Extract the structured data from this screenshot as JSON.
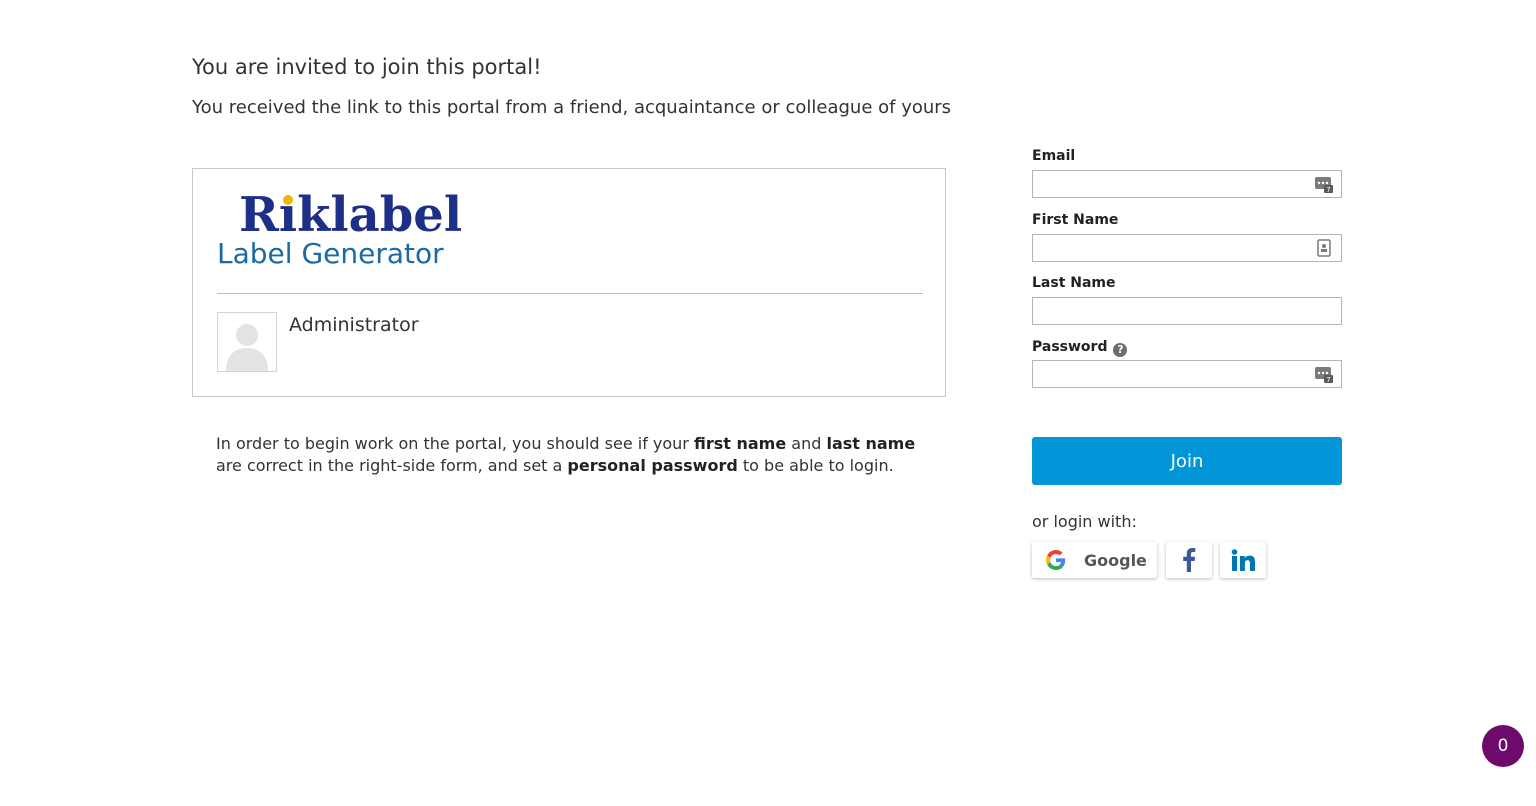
{
  "header": {
    "title": "You are invited to join this portal!",
    "subtitle": "You received the link to this portal from a friend, acquaintance or colleague of yours"
  },
  "portal": {
    "logo_text": "Riklabel",
    "subtitle": "Label Generator",
    "owner_name": "Administrator",
    "brand_color": "#1d2f86",
    "logo_dot_color": "#f2b705"
  },
  "instructions": {
    "part1": "In order to begin work on the portal, you should see if your ",
    "bold1": "first name",
    "part2": " and ",
    "bold2": "last name",
    "part3": " are correct in the right-side form, and set a ",
    "bold3": "personal password",
    "part4": " to be able to login."
  },
  "form": {
    "email_label": "Email",
    "email_value": "",
    "first_name_label": "First Name",
    "first_name_value": "",
    "last_name_label": "Last Name",
    "last_name_value": "",
    "password_label": "Password",
    "password_value": "",
    "help_icon": "question-circle-icon",
    "join_label": "Join",
    "join_color": "#0296d9"
  },
  "social": {
    "or_login_with": "or login with:",
    "google_label": "Google"
  },
  "chat": {
    "count": "0",
    "color": "#6d0a6b"
  }
}
